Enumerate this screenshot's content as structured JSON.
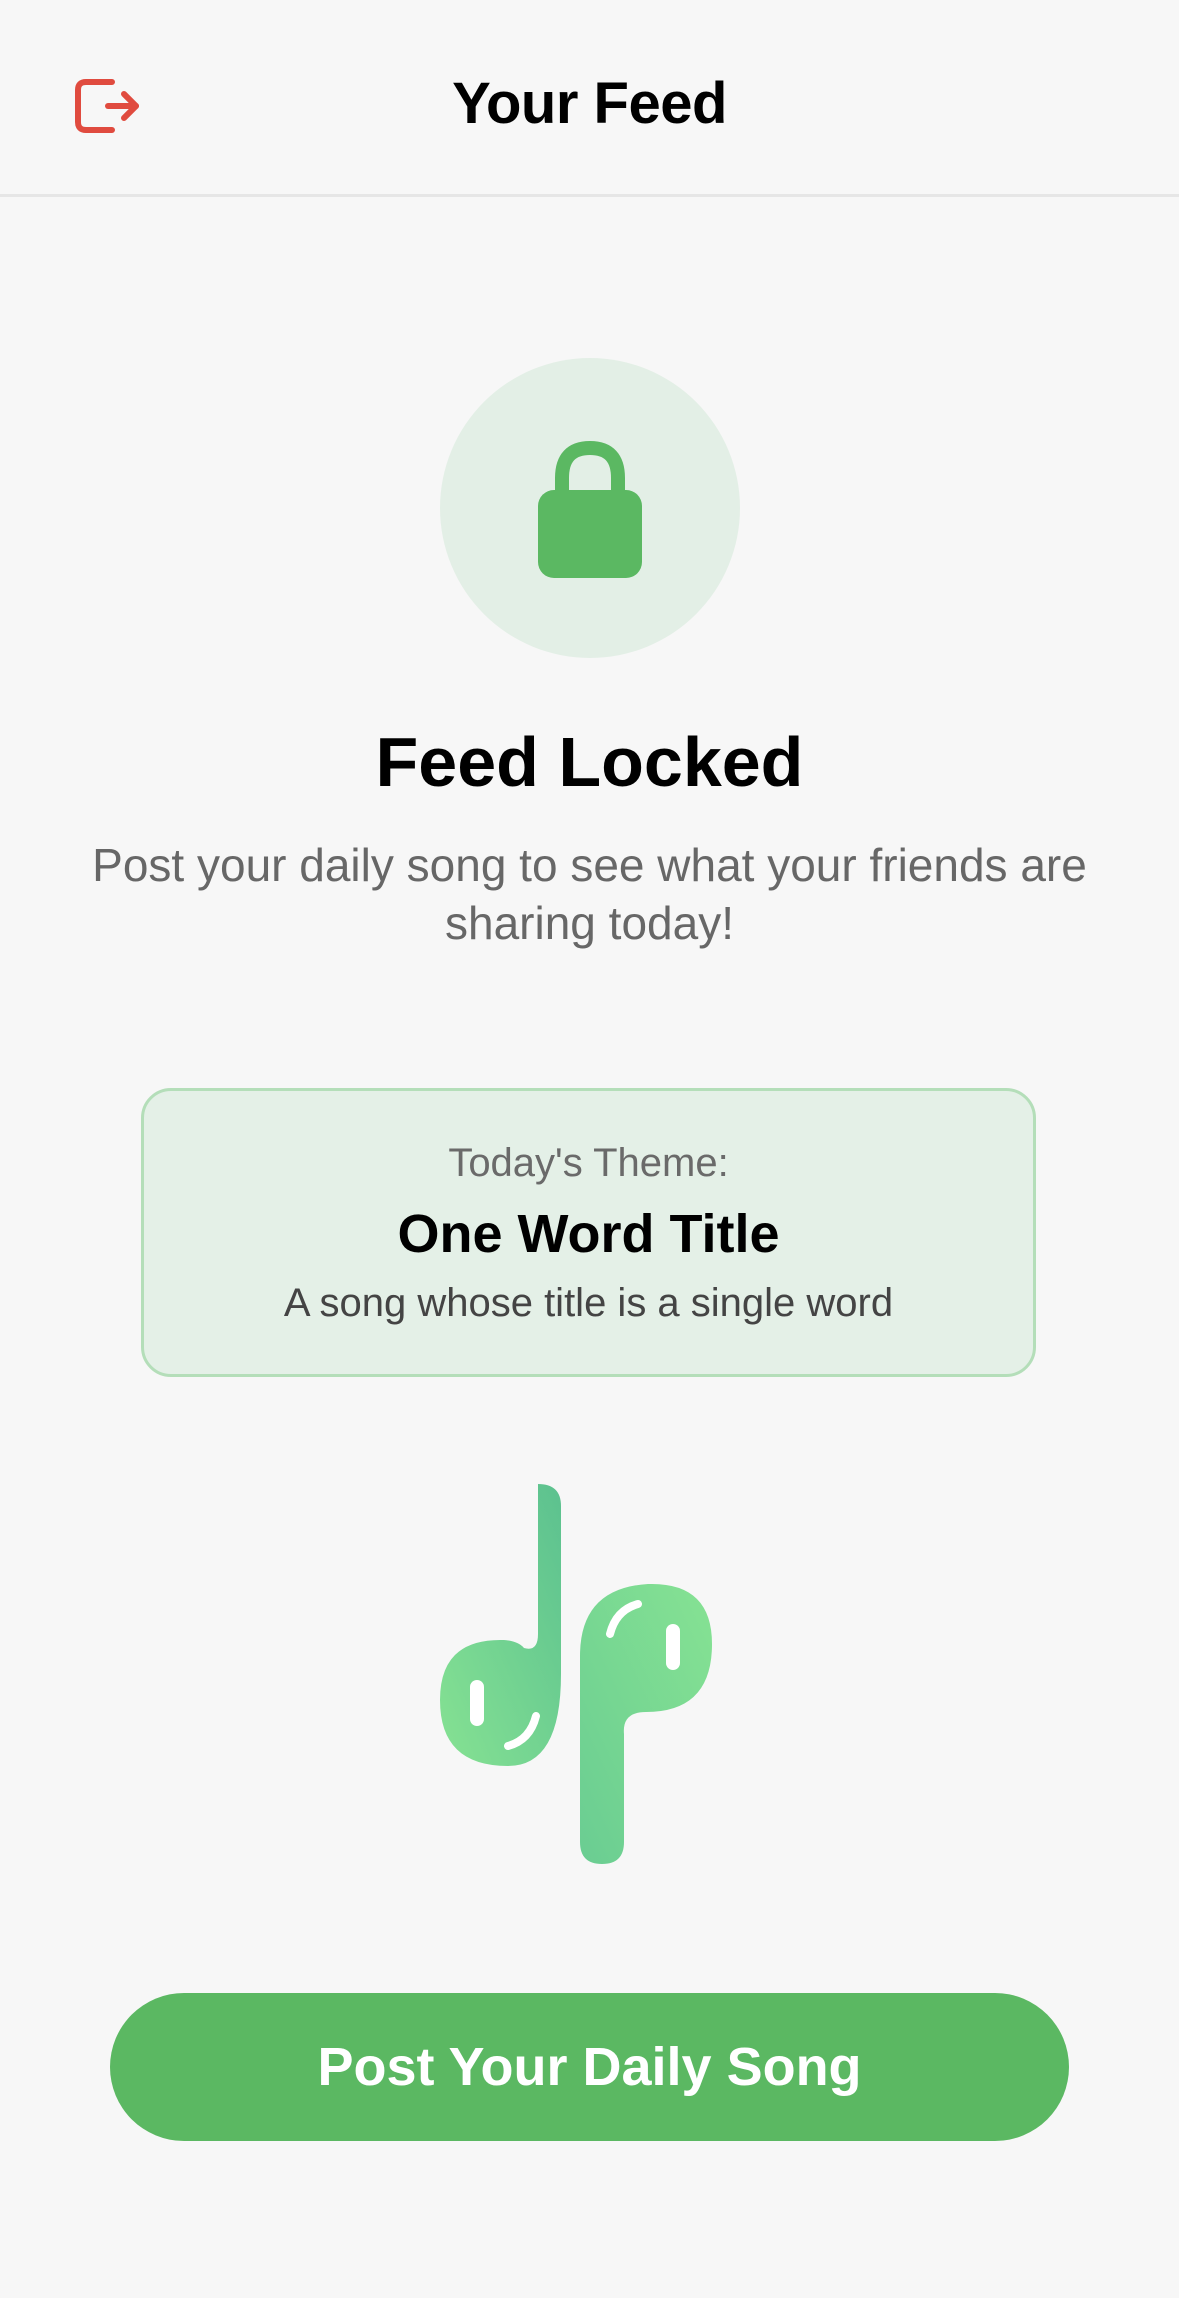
{
  "header": {
    "title": "Your Feed",
    "logout_icon": "logout-icon"
  },
  "locked": {
    "icon": "lock-icon",
    "title": "Feed Locked",
    "subtitle": "Post your daily song to see what your friends are sharing today!"
  },
  "theme": {
    "label": "Today's Theme:",
    "name": "One Word Title",
    "description": "A song whose title is a single word"
  },
  "illustration": {
    "icon": "earbuds-icon"
  },
  "cta": {
    "label": "Post Your Daily Song"
  },
  "colors": {
    "accent": "#5bb862",
    "accent_light": "#e3efe6",
    "logout": "#e04b3f"
  }
}
